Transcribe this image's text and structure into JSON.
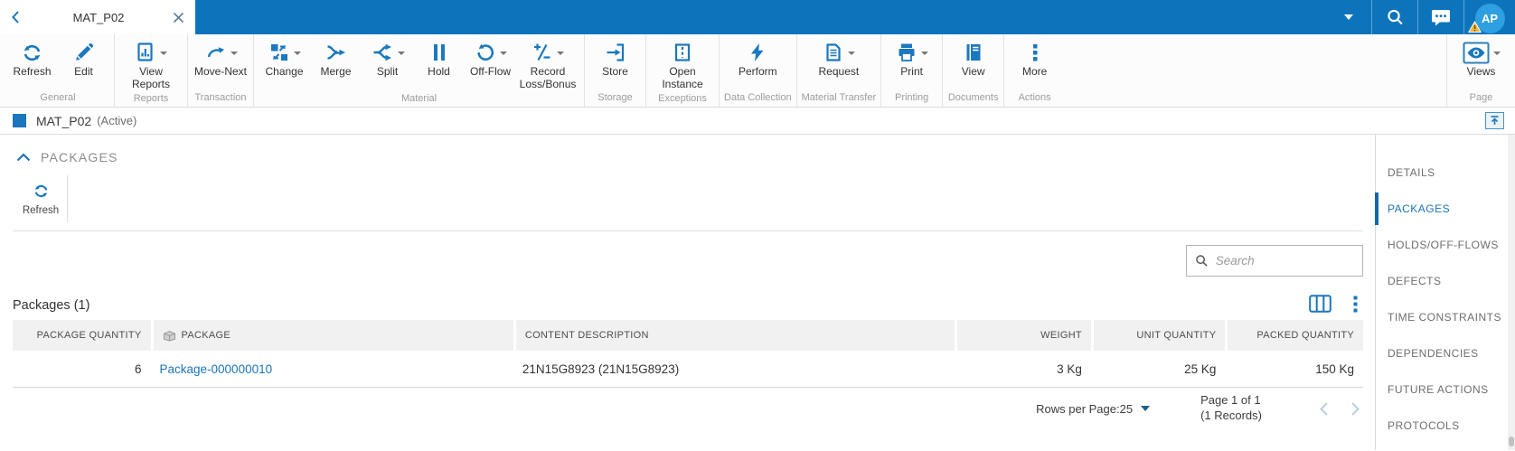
{
  "topbar": {
    "tab_title": "MAT_P02",
    "avatar_initials": "AP"
  },
  "ribbon": {
    "groups": [
      {
        "label": "General",
        "buttons": [
          {
            "label": "Refresh"
          },
          {
            "label": "Edit"
          }
        ]
      },
      {
        "label": "Reports",
        "buttons": [
          {
            "label": "View Reports"
          }
        ]
      },
      {
        "label": "Transaction",
        "buttons": [
          {
            "label": "Move-Next"
          }
        ]
      },
      {
        "label": "Material",
        "buttons": [
          {
            "label": "Change"
          },
          {
            "label": "Merge"
          },
          {
            "label": "Split"
          },
          {
            "label": "Hold"
          },
          {
            "label": "Off-Flow"
          },
          {
            "label": "Record Loss/Bonus"
          }
        ]
      },
      {
        "label": "Storage",
        "buttons": [
          {
            "label": "Store"
          }
        ]
      },
      {
        "label": "Exceptions",
        "buttons": [
          {
            "label": "Open Instance"
          }
        ]
      },
      {
        "label": "Data Collection",
        "buttons": [
          {
            "label": "Perform"
          }
        ]
      },
      {
        "label": "Material Transfer",
        "buttons": [
          {
            "label": "Request"
          }
        ]
      },
      {
        "label": "Printing",
        "buttons": [
          {
            "label": "Print"
          }
        ]
      },
      {
        "label": "Documents",
        "buttons": [
          {
            "label": "View"
          }
        ]
      },
      {
        "label": "Actions",
        "buttons": [
          {
            "label": "More"
          }
        ]
      }
    ],
    "page_group": {
      "label": "Page",
      "button_label": "Views"
    }
  },
  "status_bar": {
    "title": "MAT_P02",
    "status": "(Active)"
  },
  "section": {
    "title": "PACKAGES",
    "refresh_label": "Refresh"
  },
  "search": {
    "placeholder": "Search"
  },
  "packages": {
    "title": "Packages (1)",
    "columns": [
      "PACKAGE QUANTITY",
      "PACKAGE",
      "CONTENT DESCRIPTION",
      "WEIGHT",
      "UNIT QUANTITY",
      "PACKED QUANTITY"
    ],
    "rows": [
      {
        "package_quantity": "6",
        "package": "Package-000000010",
        "content_description": "21N15G8923 (21N15G8923)",
        "weight": "3 Kg",
        "unit_quantity": "25 Kg",
        "packed_quantity": "150 Kg"
      }
    ],
    "pagination": {
      "rows_per_page_label": "Rows per Page:",
      "rows_per_page_value": "25",
      "page_info": "Page 1 of 1",
      "records_info": "(1 Records)"
    }
  },
  "sidebar": {
    "items": [
      {
        "label": "DETAILS",
        "active": false
      },
      {
        "label": "PACKAGES",
        "active": true
      },
      {
        "label": "HOLDS/OFF-FLOWS",
        "active": false
      },
      {
        "label": "DEFECTS",
        "active": false
      },
      {
        "label": "TIME CONSTRAINTS",
        "active": false
      },
      {
        "label": "DEPENDENCIES",
        "active": false
      },
      {
        "label": "FUTURE ACTIONS",
        "active": false
      },
      {
        "label": "PROTOCOLS",
        "active": false
      }
    ]
  },
  "colors": {
    "topbar_blue": "#0d74bc",
    "icon_blue": "#1b78be",
    "link_blue": "#1a74b8",
    "active_nav_blue": "#1266a8",
    "warning_yellow": "#f2b632"
  }
}
